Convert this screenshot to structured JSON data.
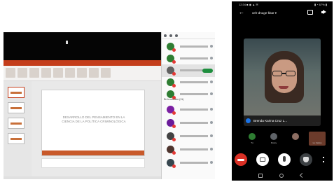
{
  "colors": {
    "powerpoint_accent": "#c43e1c",
    "meet_end_call": "#d93025",
    "meet_active_mic": "#1a73e8",
    "pinned_badge": "#1e8e3e"
  },
  "laptop": {
    "slide": {
      "title_line1": "DESARROLLO DEL PENSAMIENTO EN LA",
      "title_line2": "CIENCIA DE LA POLÍTICA CRIMINOLÓGICA"
    },
    "slide_thumbnails": [
      "slide-1",
      "slide-2",
      "slide-3",
      "slide-4"
    ],
    "participants_panel": {
      "section_label": "En la reunión (11)",
      "participants": [
        {
          "avatar_color": "#2e7d32"
        },
        {
          "avatar_color": "#2e7d32"
        },
        {
          "avatar_color": "#616161",
          "selected": true
        },
        {
          "avatar_color": "#2e7d32"
        },
        {
          "avatar_color": "#2e7d32"
        },
        {
          "avatar_color": "#7b1fa2"
        },
        {
          "avatar_color": "#6a1b9a"
        },
        {
          "avatar_color": "#424242"
        },
        {
          "avatar_color": "#4e342e"
        },
        {
          "avatar_color": "#37474f"
        }
      ]
    }
  },
  "phone": {
    "status_left": "12:34 ■ ◉ ▲ ✉",
    "status_right": "▮ ◔ 67% ▮",
    "meeting_code": "xeh-dnuge-kbar ▾",
    "speaker_name": "Brenda Karina Cruz L...",
    "strip_items": [
      {
        "label": "Tú",
        "color": "#2e7d32"
      },
      {
        "label": "Rossy",
        "color": "#5f6368"
      },
      {
        "label": "",
        "color": "#8d6e63"
      },
      {
        "label": "Lu Carlos",
        "color": "#6b3b2b"
      }
    ],
    "icons": {
      "end_call": "end-call-icon",
      "camera": "camera-icon",
      "mic": "mic-icon",
      "hand": "hand-raise-icon",
      "more": "more-vertical-icon"
    }
  }
}
